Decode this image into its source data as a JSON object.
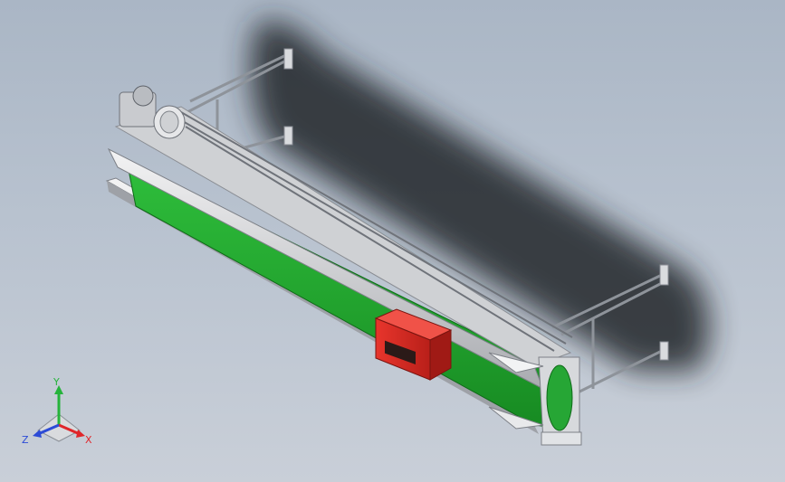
{
  "viewport": {
    "background_top": "#aab6c5",
    "background_bottom": "#c9cfd8"
  },
  "model": {
    "belt_color": "#21a32f",
    "frame_color": "#c8c9cc",
    "control_box_color": "#d42a22",
    "motor_color": "#d4d6d9",
    "shadow_color": "#2a2c30"
  },
  "triad": {
    "x_label": "X",
    "y_label": "Y",
    "z_label": "Z",
    "x_color": "#e0262a",
    "y_color": "#25b33b",
    "z_color": "#2c4bd6"
  }
}
